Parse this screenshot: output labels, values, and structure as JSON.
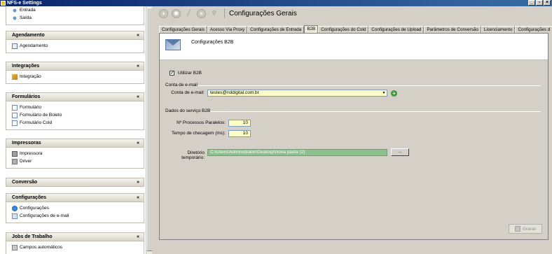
{
  "window": {
    "title": "NFS-e Settings"
  },
  "sidebar": {
    "top_items": [
      {
        "label": "Entrada",
        "icon": "entrada-icon"
      },
      {
        "label": "Saída",
        "icon": "saida-icon"
      }
    ],
    "sections": [
      {
        "title": "Agendamento",
        "items": [
          {
            "label": "Agendamento",
            "icon": "calendar-icon"
          }
        ]
      },
      {
        "title": "Integrações",
        "items": [
          {
            "label": "Integração",
            "icon": "integration-icon"
          }
        ]
      },
      {
        "title": "Formulários",
        "items": [
          {
            "label": "Formulário",
            "icon": "document-icon"
          },
          {
            "label": "Formulário de Boleto",
            "icon": "document-icon"
          },
          {
            "label": "Formulário Cold",
            "icon": "document-icon"
          }
        ]
      },
      {
        "title": "Impressoras",
        "items": [
          {
            "label": "Impressora",
            "icon": "printer-icon"
          },
          {
            "label": "Driver",
            "icon": "driver-icon"
          }
        ]
      },
      {
        "title": "Conversão",
        "items": []
      },
      {
        "title": "Configurações",
        "items": [
          {
            "label": "Configurações",
            "icon": "globe-icon"
          },
          {
            "label": "Configurações de e-mail",
            "icon": "email-icon"
          }
        ]
      },
      {
        "title": "Jobs de Trabalho",
        "items": [
          {
            "label": "Campos automáticos",
            "icon": "fields-icon"
          }
        ]
      }
    ]
  },
  "toolbar": {
    "title": "Configurações Gerais"
  },
  "tabs": [
    "Configurações Gerais",
    "Acesso Via Proxy",
    "Configurações de Entrada",
    "B2B",
    "Configurações do Cold",
    "Configurações de Upload",
    "Parâmetros de Conversão",
    "Licenciamento",
    "Configurações d"
  ],
  "active_tab": "B2B",
  "panel": {
    "header_title": "Configurações B2B",
    "use_b2b_label": "Utilizar B2B",
    "use_b2b_checked": true,
    "email_group": {
      "title": "Conta de e-mail",
      "account_label": "Conta de e-mail:",
      "account_value": "testes@nddigital.com.br"
    },
    "service_group": {
      "title": "Dados do serviço B2B",
      "parallel_label": "Nº Processos Paralelos:",
      "parallel_value": "10",
      "check_label": "Tempo de checagem (ms):",
      "check_value": "10"
    },
    "temp_dir_label": "Diretório temporário:",
    "temp_dir_value": "C:\\Users\\Administrator\\Desktop\\Nova pasta (2)",
    "browse_label": "...",
    "save_label": "Gravar"
  },
  "colors": {
    "accent": "#ffffc8",
    "path_field": "#8cc08c",
    "titlebar": "#0a246a"
  }
}
